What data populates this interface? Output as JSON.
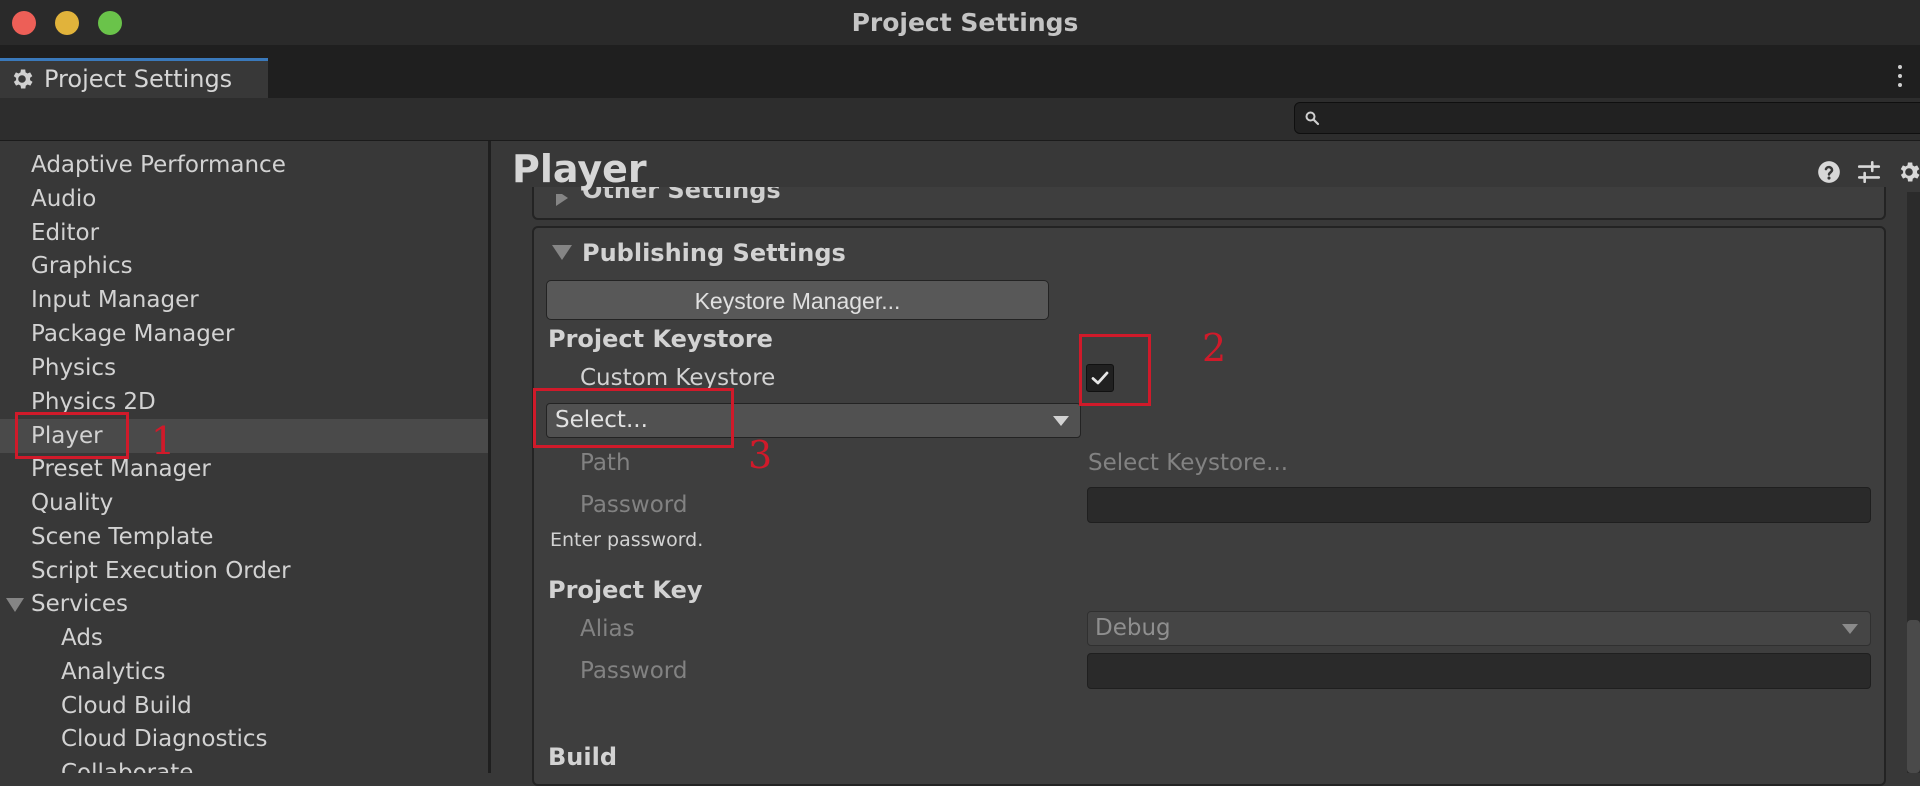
{
  "window": {
    "title": "Project Settings",
    "traffic_lights": {
      "close": "#ed5f57",
      "minimize": "#e1b33b",
      "zoom": "#6ac34a"
    }
  },
  "tab": {
    "label": "Project Settings",
    "icon": "gear-icon"
  },
  "search": {
    "placeholder": "",
    "icon": "search-icon"
  },
  "sidebar": {
    "items": [
      "Adaptive Performance",
      "Audio",
      "Editor",
      "Graphics",
      "Input Manager",
      "Package Manager",
      "Physics",
      "Physics 2D",
      "Player",
      "Preset Manager",
      "Quality",
      "Scene Template",
      "Script Execution Order",
      "Services"
    ],
    "selected": "Player",
    "services_children": [
      "Ads",
      "Analytics",
      "Cloud Build",
      "Cloud Diagnostics",
      "Collaborate"
    ]
  },
  "main": {
    "title": "Player",
    "header_icons": [
      "help-icon",
      "preset-sliders-icon",
      "gear-icon"
    ],
    "other_settings_label": "Other Settings",
    "publishing": {
      "label": "Publishing Settings",
      "keystore_manager_button": "Keystore Manager...",
      "project_keystore_label": "Project Keystore",
      "custom_keystore_label": "Custom Keystore",
      "custom_keystore_checked": true,
      "keystore_select_value": "Select...",
      "path_label": "Path",
      "path_value": "Select Keystore...",
      "password_label": "Password",
      "password_value": "",
      "enter_password_hint": "Enter password.",
      "project_key_label": "Project Key",
      "alias_label": "Alias",
      "alias_value": "Debug",
      "key_password_label": "Password",
      "key_password_value": "",
      "build_label": "Build"
    }
  },
  "annotations": {
    "color": "#d01a2a",
    "labels": [
      "1",
      "2",
      "3"
    ]
  }
}
